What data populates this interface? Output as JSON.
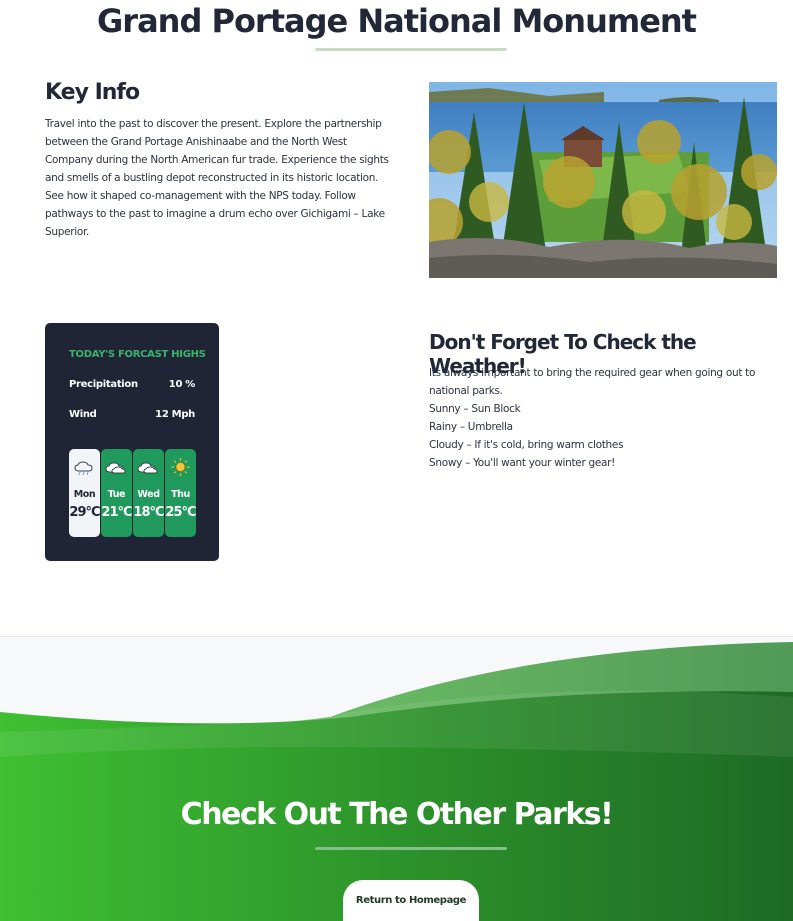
{
  "page": {
    "title": "Grand Portage National Monument"
  },
  "key_info": {
    "heading": "Key Info",
    "text": "Travel into the past to discover the present. Explore the partnership between the Grand Portage Anishinaabe and the North West Company during the North American fur trade. Experience the sights and smells of a bustling depot reconstructed in its historic location. See how it shaped co-management with the NPS today. Follow pathways to the past to imagine a drum echo over Gichigami – Lake Superior."
  },
  "weather_widget": {
    "title": "TODAY'S FORCAST HIGHS",
    "precipitation_label": "Precipitation",
    "precipitation_value": "10 %",
    "wind_label": "Wind",
    "wind_value": "12 Mph",
    "days": [
      {
        "name": "Mon",
        "temp": "29°C",
        "icon": "rain-cloud-icon"
      },
      {
        "name": "Tue",
        "temp": "21°C",
        "icon": "cloud-icon"
      },
      {
        "name": "Wed",
        "temp": "18°C",
        "icon": "cloud-icon"
      },
      {
        "name": "Thu",
        "temp": "25°C",
        "icon": "sun-icon"
      }
    ]
  },
  "weather_info": {
    "heading": "Don't Forget To Check the Weather!",
    "lines": [
      "Its always important to bring the required gear when going out to national parks.",
      "Sunny – Sun Block",
      "Rainy – Umbrella",
      "Cloudy – If it's cold, bring warm clothes",
      "Snowy – You'll want your winter gear!"
    ]
  },
  "footer": {
    "heading": "Check Out The Other Parks!",
    "button_label": "Return to Homepage"
  },
  "colors": {
    "accent_green": "#3bb36b",
    "dark_card": "#1f2535",
    "footer_green_light": "#3fbf33",
    "footer_green_dark": "#1e6a25"
  }
}
